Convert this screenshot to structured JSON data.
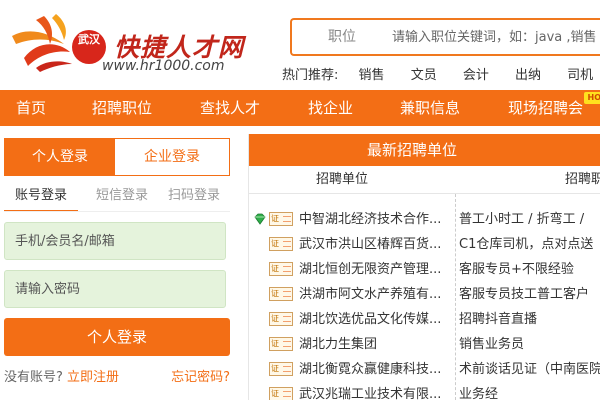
{
  "logo": {
    "badge": "武汉",
    "title": "快捷人才网",
    "url": "www.hr1000.com"
  },
  "search": {
    "type_label": "职位",
    "placeholder": "请输入职位关键词，如：java ,销售"
  },
  "hot": {
    "label": "热门推荐:",
    "items": [
      "销售",
      "文员",
      "会计",
      "出纳",
      "司机"
    ]
  },
  "nav": {
    "items": [
      "首页",
      "招聘职位",
      "查找人才",
      "找企业",
      "兼职信息",
      "现场招聘会"
    ],
    "hot_tag": "HOT"
  },
  "login": {
    "tab_personal": "个人登录",
    "tab_company": "企业登录",
    "sub_tabs": [
      "账号登录",
      "短信登录",
      "扫码登录"
    ],
    "account_placeholder": "手机/会员名/邮箱",
    "password_placeholder": "请输入密码",
    "button": "个人登录",
    "no_account": "没有账号?",
    "register": "立即注册",
    "forgot": "忘记密码?"
  },
  "recruit": {
    "title": "最新招聘单位",
    "col_company": "招聘单位",
    "col_jobs": "招聘职",
    "rows": [
      {
        "company": "中智湖北经济技术合作...",
        "jobs": "普工小时工 / 折弯工 /",
        "gem": true
      },
      {
        "company": "武汉市洪山区椿辉百货...",
        "jobs": "C1仓库司机，点对点送",
        "gem": false
      },
      {
        "company": "湖北恒创无限资产管理...",
        "jobs": "客服专员+不限经验",
        "gem": false
      },
      {
        "company": "洪湖市阿文水产养殖有...",
        "jobs": "客服专员技工普工客户",
        "gem": false
      },
      {
        "company": "湖北饮选优品文化传媒...",
        "jobs": "招聘抖音直播",
        "gem": false
      },
      {
        "company": "湖北力生集团",
        "jobs": "销售业务员",
        "gem": false
      },
      {
        "company": "湖北衡霓众赢健康科技...",
        "jobs": "术前谈话见证（中南医院",
        "gem": false
      },
      {
        "company": "武汉兆瑞工业技术有限...",
        "jobs": "业务经",
        "gem": false
      }
    ]
  }
}
